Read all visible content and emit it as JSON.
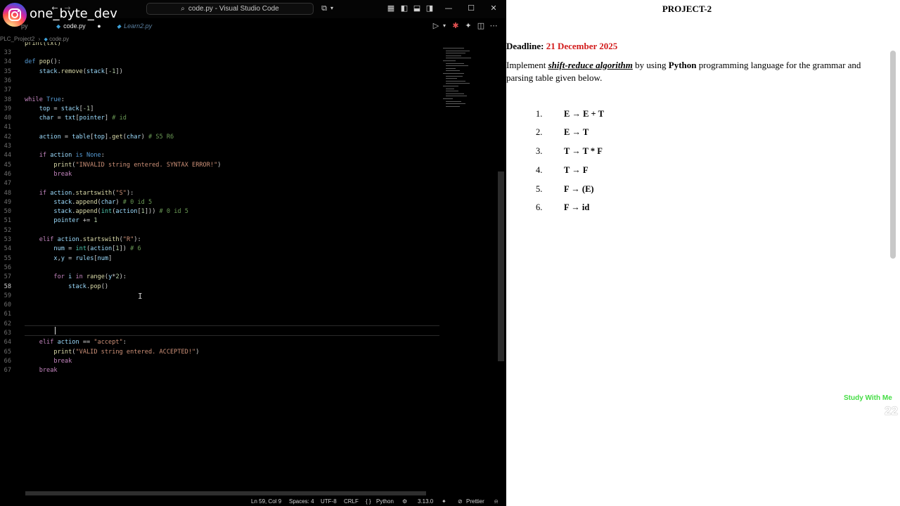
{
  "watermark": {
    "handle": "one_byte_dev"
  },
  "titlebar": {
    "search_text": "code.py - Visual Studio Code"
  },
  "tabs": [
    {
      "label": "py"
    },
    {
      "label": "code.py",
      "active": true
    },
    {
      "label": "Learn2.py"
    }
  ],
  "breadcrumb": {
    "folder": "PLC_Project2",
    "file": "code.py"
  },
  "editor": {
    "top_fragment": "print(txt)",
    "line_numbers": [
      "33",
      "34",
      "35",
      "36",
      "37",
      "38",
      "39",
      "40",
      "41",
      "42",
      "43",
      "44",
      "45",
      "46",
      "47",
      "48",
      "49",
      "50",
      "51",
      "52",
      "53",
      "54",
      "55",
      "56",
      "57",
      "58",
      "59",
      "60",
      "61",
      "62",
      "63",
      "64",
      "65",
      "66",
      "67"
    ],
    "current_line": "58"
  },
  "status": {
    "position": "Ln 59, Col 9",
    "spaces": "Spaces: 4",
    "encoding": "UTF-8",
    "eol": "CRLF",
    "braces": "{ }",
    "language": "Python",
    "version": "3.13.0",
    "prettier": "Prettier"
  },
  "document": {
    "title": "PROJECT-2",
    "deadline_label": "Deadline:",
    "deadline_date": "21 December 2025",
    "instr_1": "Implement",
    "instr_algo": "shift-reduce algorithm",
    "instr_2": "by using",
    "instr_lang": "Python",
    "instr_3": "programming language for the grammar and parsing table given below.",
    "rules": [
      {
        "num": "1.",
        "text": "E → E + T"
      },
      {
        "num": "2.",
        "text": "E → T"
      },
      {
        "num": "3.",
        "text": "T → T * F"
      },
      {
        "num": "4.",
        "text": "T → F"
      },
      {
        "num": "5.",
        "text": "F → (E)"
      },
      {
        "num": "6.",
        "text": "F → id"
      }
    ]
  },
  "overlay": {
    "study_label": "Study With Me",
    "timer": "22"
  },
  "colors": {
    "accent_red": "#d21a1a",
    "keyword": "#c586c0",
    "string": "#ce9178",
    "comment": "#6a9955",
    "study_green": "#44dd44"
  }
}
